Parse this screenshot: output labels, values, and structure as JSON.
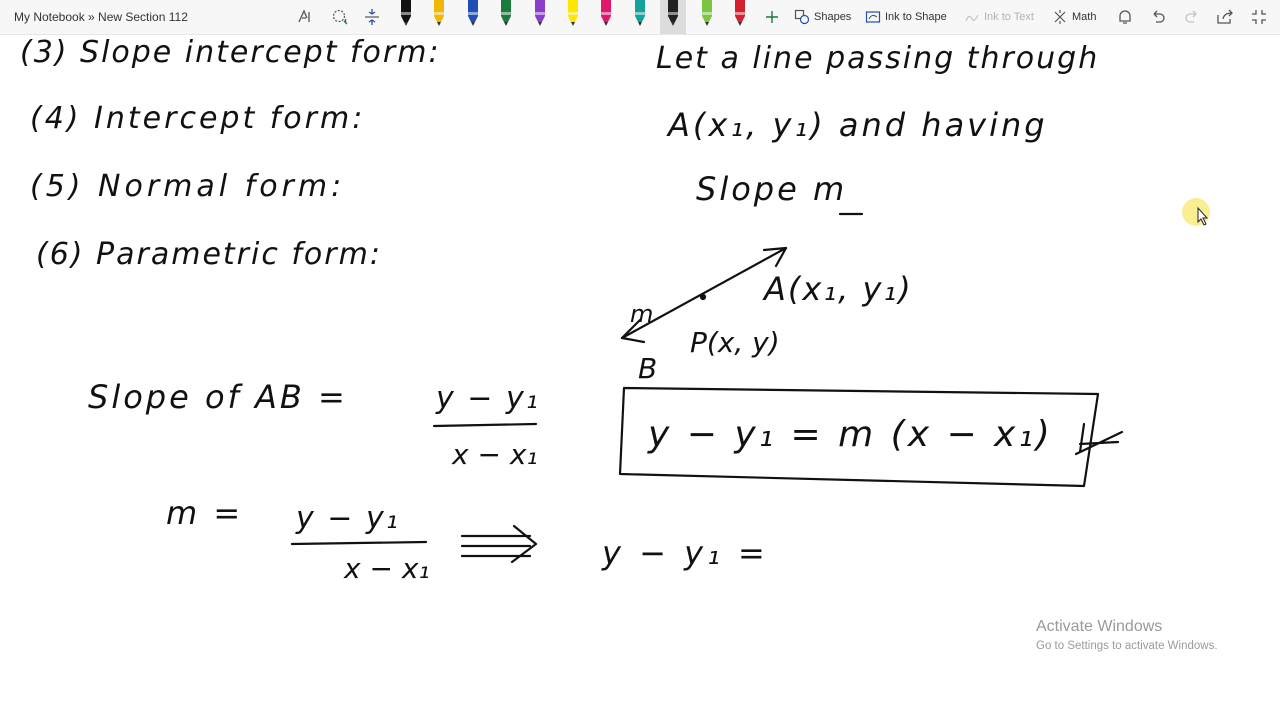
{
  "breadcrumb": "My Notebook » New Section 112",
  "toolbar": {
    "shapes_label": "Shapes",
    "ink_to_shape_label": "Ink to Shape",
    "ink_to_text_label": "Ink to Text",
    "math_label": "Math"
  },
  "pens": [
    {
      "name": "black-pen",
      "color": "#111111"
    },
    {
      "name": "yellow-pen",
      "color": "#f2b705"
    },
    {
      "name": "blue-pen",
      "color": "#1f4fb5"
    },
    {
      "name": "green-pen",
      "color": "#1c7a3c"
    },
    {
      "name": "purple-pen",
      "color": "#8a3ec9"
    },
    {
      "name": "highlighter-yellow",
      "color": "#ffe600"
    },
    {
      "name": "magenta-pen",
      "color": "#e0186c"
    },
    {
      "name": "teal-pen",
      "color": "#13a39a"
    },
    {
      "name": "selected-pen",
      "color": "#222222"
    },
    {
      "name": "light-green-pen",
      "color": "#7dc443"
    },
    {
      "name": "red-pen",
      "color": "#d4202f"
    }
  ],
  "notes": {
    "list_3": "(3) Slope intercept form:",
    "list_4": "(4) Intercept form:",
    "list_5": "(5) Normal form:",
    "list_6": "(6) Parametric form:",
    "right_1": "Let a line passing through",
    "right_2": "A(x₁, y₁) and having",
    "right_3": "Slope m",
    "label_m": "m",
    "label_A": "A(x₁, y₁)",
    "label_P": "P(x, y)",
    "label_B": "B",
    "slope_left": "Slope of AB =",
    "frac1_num": "y − y₁",
    "frac1_den": "x − x₁",
    "m_eq": "m =",
    "frac2_num": "y − y₁",
    "frac2_den": "x − x₁",
    "result_left": "y − y₁ =",
    "boxed_eq": "y − y₁ = m (x − x₁)"
  },
  "watermark": {
    "title": "Activate Windows",
    "subtitle": "Go to Settings to activate Windows."
  }
}
